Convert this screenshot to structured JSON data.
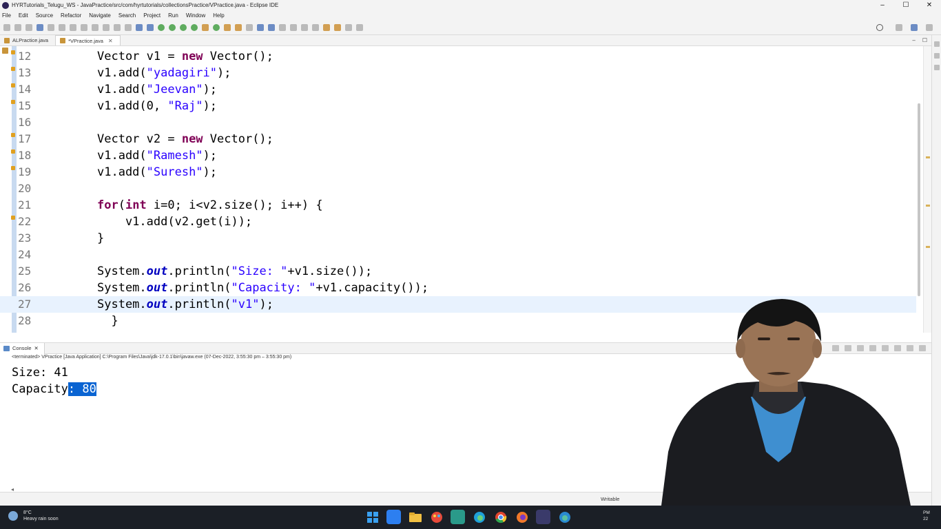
{
  "window": {
    "title": "HYRTutorials_Telugu_WS - JavaPractice/src/com/hyrtutorials/collectionsPractice/VPractice.java - Eclipse IDE",
    "controls": [
      "–",
      "☐",
      "✕"
    ]
  },
  "menu": [
    "File",
    "Edit",
    "Source",
    "Refactor",
    "Navigate",
    "Search",
    "Project",
    "Run",
    "Window",
    "Help"
  ],
  "editor_tabs": [
    {
      "label": "ALPractice.java",
      "active": false
    },
    {
      "label": "*VPractice.java",
      "active": true
    }
  ],
  "code_lines": [
    {
      "n": "12",
      "warn": true,
      "current": false,
      "parts": [
        [
          "p",
          "Vector v1 = "
        ],
        [
          "kw",
          "new"
        ],
        [
          "p",
          " Vector();"
        ]
      ]
    },
    {
      "n": "13",
      "warn": true,
      "current": false,
      "parts": [
        [
          "p",
          "v1.add("
        ],
        [
          "str",
          "\"yadagiri\""
        ],
        [
          "p",
          ");"
        ]
      ]
    },
    {
      "n": "14",
      "warn": true,
      "current": false,
      "parts": [
        [
          "p",
          "v1.add("
        ],
        [
          "str",
          "\"Jeevan\""
        ],
        [
          "p",
          ");"
        ]
      ]
    },
    {
      "n": "15",
      "warn": true,
      "current": false,
      "parts": [
        [
          "p",
          "v1.add(0, "
        ],
        [
          "str",
          "\"Raj\""
        ],
        [
          "p",
          ");"
        ]
      ]
    },
    {
      "n": "16",
      "warn": false,
      "current": false,
      "parts": []
    },
    {
      "n": "17",
      "warn": true,
      "current": false,
      "parts": [
        [
          "p",
          "Vector v2 = "
        ],
        [
          "kw",
          "new"
        ],
        [
          "p",
          " Vector();"
        ]
      ]
    },
    {
      "n": "18",
      "warn": true,
      "current": false,
      "parts": [
        [
          "p",
          "v1.add("
        ],
        [
          "str",
          "\"Ramesh\""
        ],
        [
          "p",
          ");"
        ]
      ]
    },
    {
      "n": "19",
      "warn": true,
      "current": false,
      "parts": [
        [
          "p",
          "v1.add("
        ],
        [
          "str",
          "\"Suresh\""
        ],
        [
          "p",
          ");"
        ]
      ]
    },
    {
      "n": "20",
      "warn": false,
      "current": false,
      "parts": []
    },
    {
      "n": "21",
      "warn": false,
      "current": false,
      "parts": [
        [
          "kw",
          "for"
        ],
        [
          "p",
          "("
        ],
        [
          "kw",
          "int"
        ],
        [
          "p",
          " i=0; i<v2.size(); i++) {"
        ]
      ]
    },
    {
      "n": "22",
      "warn": true,
      "current": false,
      "parts": [
        [
          "p",
          "    v1.add(v2.get(i));"
        ]
      ]
    },
    {
      "n": "23",
      "warn": false,
      "current": false,
      "parts": [
        [
          "p",
          "}"
        ]
      ]
    },
    {
      "n": "24",
      "warn": false,
      "current": false,
      "parts": []
    },
    {
      "n": "25",
      "warn": false,
      "current": false,
      "parts": [
        [
          "p",
          "System."
        ],
        [
          "fld",
          "out"
        ],
        [
          "p",
          ".println("
        ],
        [
          "str",
          "\"Size: \""
        ],
        [
          "p",
          "+v1.size());"
        ]
      ]
    },
    {
      "n": "26",
      "warn": false,
      "current": false,
      "parts": [
        [
          "p",
          "System."
        ],
        [
          "fld",
          "out"
        ],
        [
          "p",
          ".println("
        ],
        [
          "str",
          "\"Capacity: \""
        ],
        [
          "p",
          "+v1.capacity());"
        ]
      ]
    },
    {
      "n": "27",
      "warn": false,
      "current": true,
      "parts": [
        [
          "p",
          "System."
        ],
        [
          "fld",
          "out"
        ],
        [
          "p",
          ".println("
        ],
        [
          "str",
          "\"v1\""
        ],
        [
          "p",
          ");"
        ]
      ]
    },
    {
      "n": "28",
      "warn": false,
      "current": false,
      "parts": [
        [
          "p",
          "  }"
        ]
      ]
    }
  ],
  "console": {
    "tab_label": "Console",
    "status": "<terminated> VPractice [Java Application] C:\\Program Files\\Java\\jdk-17.0.1\\bin\\javaw.exe (07-Dec-2022, 3:55:30 pm – 3:55:30 pm)",
    "output_line1": "Size: 41",
    "output_line2_prefix": "Capacity",
    "output_line2_selected": ": 80"
  },
  "statusbar": {
    "writable": "Writable"
  },
  "taskbar": {
    "temperature": "8°C",
    "weather": "Heavy rain soon",
    "clock_lines": [
      "PM",
      "22"
    ]
  },
  "colors": {
    "keyword": "#7f0055",
    "string": "#2a00ff",
    "field": "#0000c0",
    "selection": "#0a64d2",
    "current_line": "#e8f2fe"
  }
}
